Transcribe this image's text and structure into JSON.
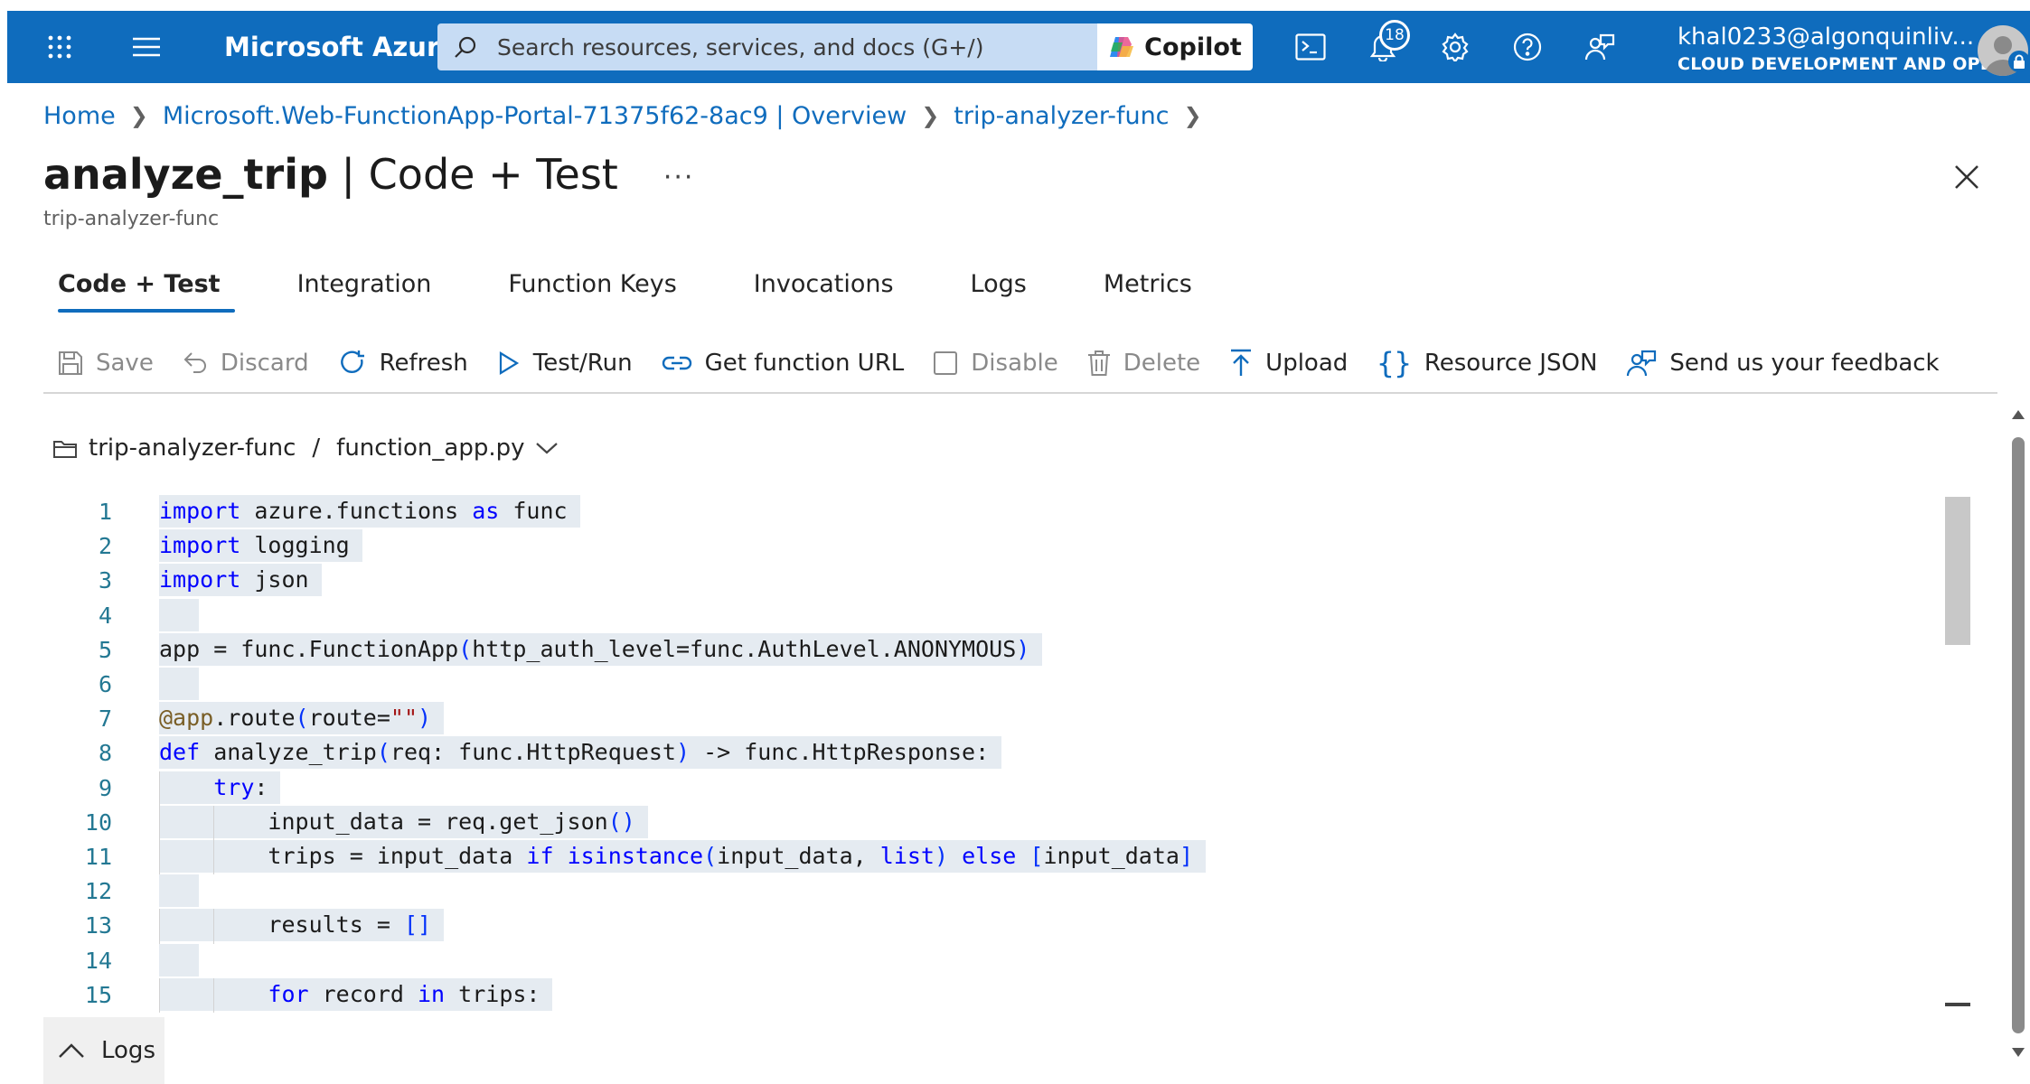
{
  "topbar": {
    "brand": "Microsoft Azure",
    "search_placeholder": "Search resources, services, and docs (G+/)",
    "copilot_label": "Copilot",
    "notification_count": "18",
    "user_name": "khal0233@algonquinliv...",
    "user_org": "CLOUD DEVELOPMENT AND OPE...",
    "accent_color": "#0f6cbd"
  },
  "breadcrumb": {
    "items": [
      "Home",
      "Microsoft.Web-FunctionApp-Portal-71375f62-8ac9 | Overview",
      "trip-analyzer-func"
    ]
  },
  "header": {
    "title_bold": "analyze_trip",
    "title_rest": " | Code + Test",
    "more": "···",
    "subtitle": "trip-analyzer-func"
  },
  "tabs": [
    "Code + Test",
    "Integration",
    "Function Keys",
    "Invocations",
    "Logs",
    "Metrics"
  ],
  "toolbar": {
    "save": "Save",
    "discard": "Discard",
    "refresh": "Refresh",
    "test_run": "Test/Run",
    "get_url": "Get function URL",
    "disable": "Disable",
    "delete": "Delete",
    "upload": "Upload",
    "resource_json": "Resource JSON",
    "feedback": "Send us your feedback"
  },
  "filepath": {
    "folder": "trip-analyzer-func",
    "separator": "/",
    "file": "function_app.py"
  },
  "editor": {
    "line_numbers": [
      "1",
      "2",
      "3",
      "4",
      "5",
      "6",
      "7",
      "8",
      "9",
      "10",
      "11",
      "12",
      "13",
      "14",
      "15"
    ],
    "lines": [
      "import azure.functions as func",
      "import logging",
      "import json",
      "",
      "app = func.FunctionApp(http_auth_level=func.AuthLevel.ANONYMOUS)",
      "",
      "@app.route(route=\"\")",
      "def analyze_trip(req: func.HttpRequest) -> func.HttpResponse:",
      "    try:",
      "        input_data = req.get_json()",
      "        trips = input_data if isinstance(input_data, list) else [input_data]",
      "",
      "        results = []",
      "",
      "        for record in trips:"
    ]
  },
  "logs_panel": {
    "label": "Logs"
  }
}
